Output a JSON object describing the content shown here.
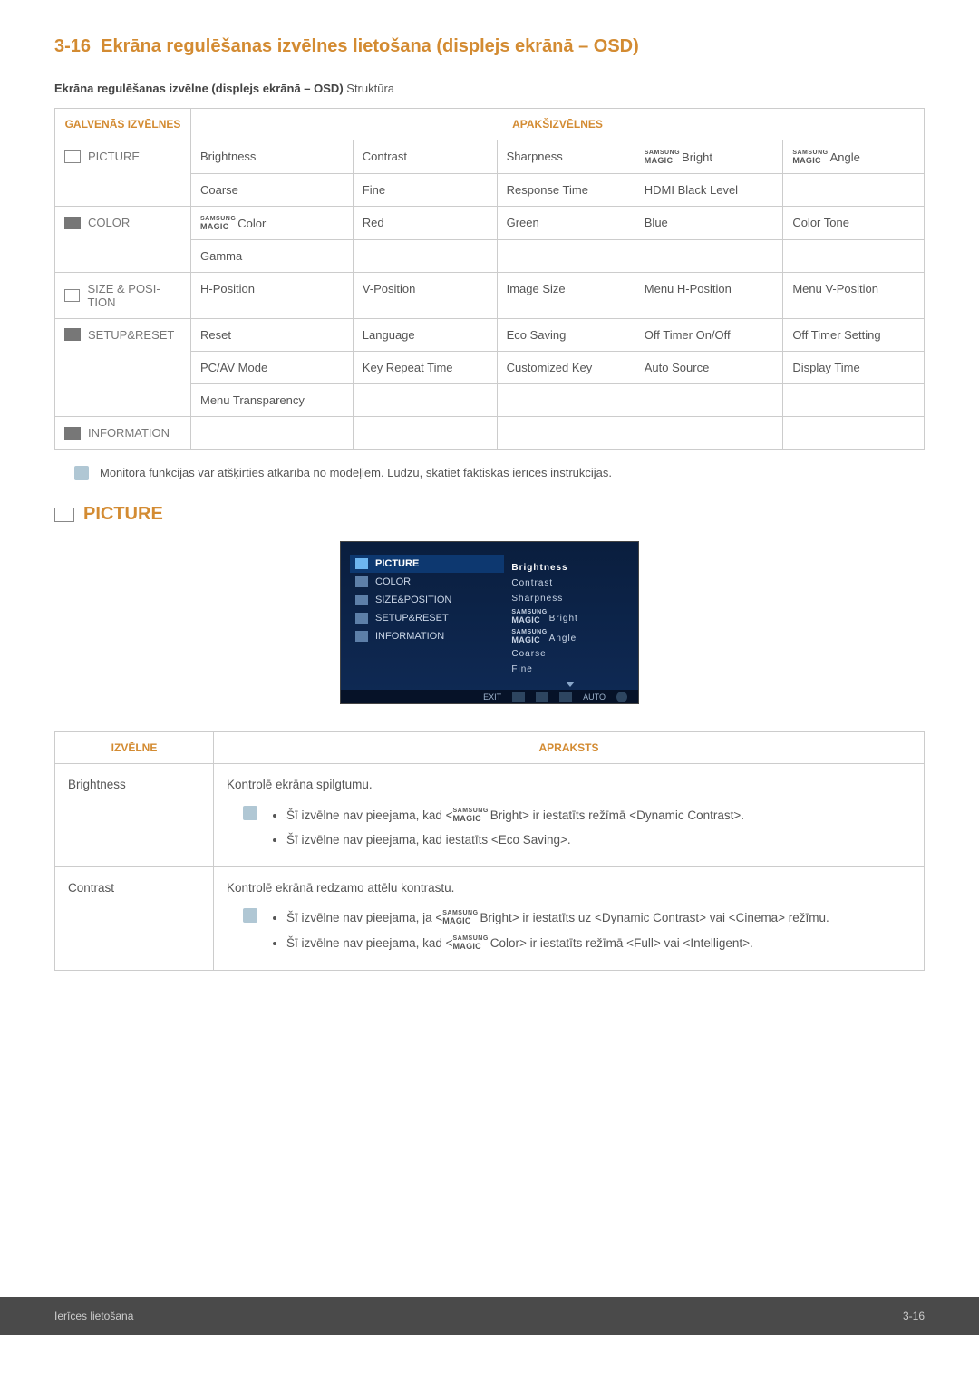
{
  "section": {
    "number": "3-16",
    "title": "Ekrāna regulēšanas izvēlnes lietošana (displejs ekrānā – OSD)"
  },
  "struct_bold": "Ekrāna regulēšanas izvēlne (displejs ekrānā – OSD)",
  "struct_rest": " Struktūra",
  "menu_table": {
    "headers": {
      "main": "GALVENĀS IZVĒLNES",
      "sub": "APAKŠIZVĒLNES"
    },
    "rows": {
      "picture": {
        "label": "PICTURE",
        "c0": "Brightness",
        "c1": "Contrast",
        "c2": "Sharpness",
        "c3": "Bright",
        "c4": "Angle",
        "c0b": "Coarse",
        "c1b": "Fine",
        "c2b": "Response Time",
        "c3b": "HDMI Black Level",
        "c4b": ""
      },
      "color": {
        "label": "COLOR",
        "c0": "Color",
        "c1": "Red",
        "c2": "Green",
        "c3": "Blue",
        "c4": "Color Tone",
        "c0b": "Gamma",
        "c1b": "",
        "c2b": "",
        "c3b": "",
        "c4b": ""
      },
      "size": {
        "label": "SIZE & POSI­TION",
        "c0": "H-Position",
        "c1": "V-Position",
        "c2": "Image Size",
        "c3": "Menu H-Position",
        "c4": "Menu V-Position"
      },
      "setup": {
        "label": "SETUP&RESET",
        "c0": "Reset",
        "c1": "Language",
        "c2": "Eco Saving",
        "c3": "Off Timer On/Off",
        "c4": "Off Timer Setting",
        "c0b": "PC/AV Mode",
        "c1b": "Key Repeat Time",
        "c2b": "Customized Key",
        "c3b": "Auto Source",
        "c4b": "Display Time",
        "c0c": "Menu Transpa­rency",
        "c1c": "",
        "c2c": "",
        "c3c": "",
        "c4c": ""
      },
      "info": {
        "label": "INFORMA­TION",
        "c0": "",
        "c1": "",
        "c2": "",
        "c3": "",
        "c4": ""
      }
    }
  },
  "note": "Monitora funkcijas var atšķirties atkarībā no modeļiem. Lūdzu, skatiet faktiskās ierīces instrukcijas.",
  "picture_heading": "PICTURE",
  "osd": {
    "left": {
      "picture": "PICTURE",
      "color": "COLOR",
      "size": "SIZE&POSITION",
      "setup": "SETUP&RESET",
      "info": "INFORMATION"
    },
    "right": {
      "i0": "Brightness",
      "i1": "Contrast",
      "i2": "Sharpness",
      "i3": "Bright",
      "i4": "Angle",
      "i5": "Coarse",
      "i6": "Fine"
    },
    "footer": {
      "exit": "EXIT",
      "auto": "AUTO"
    }
  },
  "desc_table": {
    "headers": {
      "menu": "IZVĒLNE",
      "desc": "APRAKSTS"
    },
    "brightness": {
      "label": "Brightness",
      "lead": "Kontrolē ekrāna spilgtumu.",
      "li1a": "Šī izvēlne nav pieejama, kad <",
      "li1b": "Bright> ir iestatīts režīmā <Dynamic Contrast>.",
      "li2": "Šī izvēlne nav pieejama, kad iestatīts <Eco Saving>."
    },
    "contrast": {
      "label": "Contrast",
      "lead": "Kontrolē ekrānā redzamo attēlu kontrastu.",
      "li1a": "Šī izvēlne nav pieejama, ja <",
      "li1b": "Bright> ir iestatīts uz <Dynamic Contrast> vai <Cinema> režīmu.",
      "li2a": "Šī izvēlne nav pieejama, kad <",
      "li2b": "Color> ir iestatīts režīmā <Full> vai <Intelligent>."
    }
  },
  "magic": {
    "top": "SAMSUNG",
    "bot": "MAGIC"
  },
  "magic_osd": {
    "top": "SAMSUNG",
    "bot": "MAGIC"
  },
  "footer": {
    "left": "Ierīces lietošana",
    "right": "3-16"
  }
}
